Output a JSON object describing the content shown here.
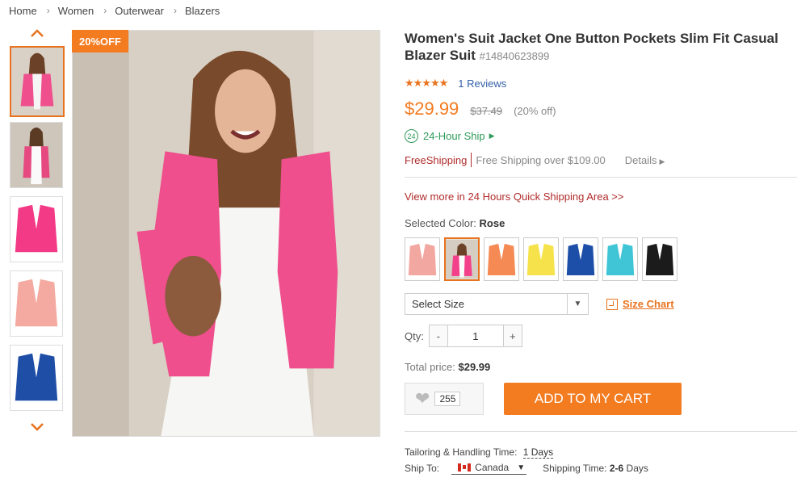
{
  "breadcrumb": [
    "Home",
    "Women",
    "Outerwear",
    "Blazers"
  ],
  "badge": "20%OFF",
  "product": {
    "title": "Women's Suit Jacket One Button Pockets Slim Fit Casual Blazer Suit",
    "sku": "#14840623899",
    "stars": "★★★★★",
    "reviews": "1 Reviews",
    "price": "$29.99",
    "old_price": "$37.49",
    "discount": "(20% off)",
    "ship_badge": "24",
    "ship_label": "24-Hour Ship",
    "free_shipping_label": "FreeShipping",
    "free_shipping_text": "Free Shipping over $109.00",
    "details_label": "Details",
    "view_more": "View more in 24 Hours Quick Shipping Area >>",
    "selected_color_label": "Selected Color:",
    "selected_color": "Rose",
    "colors": [
      {
        "name": "pink",
        "hex": "#f2a7a0"
      },
      {
        "name": "rose",
        "hex": "#f2418a"
      },
      {
        "name": "orange",
        "hex": "#f58a55"
      },
      {
        "name": "yellow",
        "hex": "#f6e24a"
      },
      {
        "name": "blue",
        "hex": "#1e4fa8"
      },
      {
        "name": "cyan",
        "hex": "#3fc5d5"
      },
      {
        "name": "black",
        "hex": "#1b1b1b"
      }
    ],
    "size_placeholder": "Select Size",
    "size_chart": "Size Chart",
    "qty_label": "Qty:",
    "qty_minus": "-",
    "qty": "1",
    "qty_plus": "+",
    "total_label": "Total price:",
    "total": "$29.99",
    "wishlist_count": "255",
    "add_to_cart": "ADD TO MY CART",
    "tailoring_label": "Tailoring & Handling Time:",
    "tailoring_value": "1 Days",
    "ship_to_label": "Ship To:",
    "country": "Canada",
    "shipping_time_label": "Shipping Time:",
    "shipping_time_value": "2-6",
    "shipping_time_unit": "Days"
  },
  "thumbnails": [
    {
      "name": "rose-front",
      "color": "#ef4f8c"
    },
    {
      "name": "rose-lifestyle",
      "color": "#e6497f"
    },
    {
      "name": "rose-flat",
      "color": "#f23a86"
    },
    {
      "name": "pink-flat",
      "color": "#f4aaa0"
    },
    {
      "name": "blue-flat",
      "color": "#1f4ea6"
    }
  ],
  "accent": "#f37b20"
}
